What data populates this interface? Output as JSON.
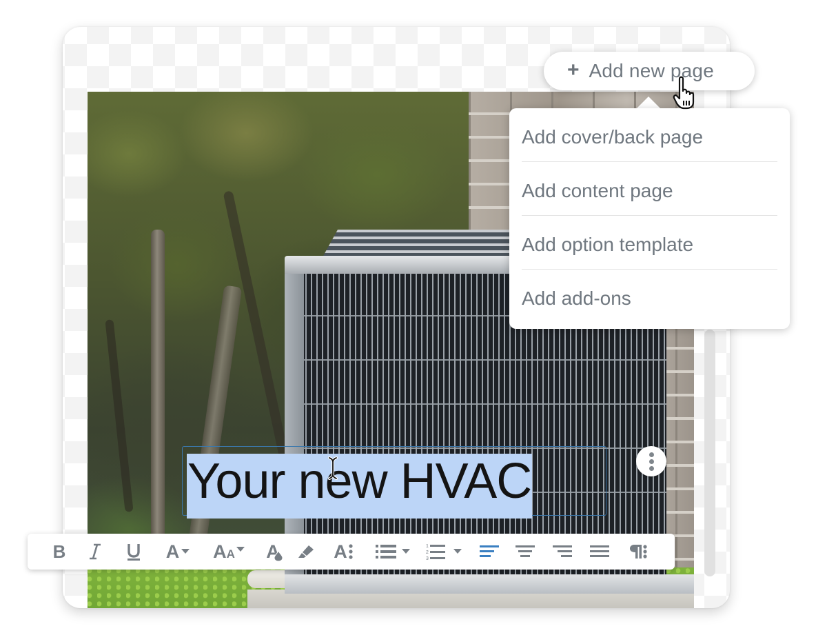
{
  "canvas": {
    "headline_text": "Your new HVAC",
    "selection_color": "#bcd5f7",
    "textbox_border_color": "#3b78ad"
  },
  "add_page": {
    "icon": "plus-icon",
    "label": "Add new page"
  },
  "add_page_menu": {
    "items": [
      {
        "label": "Add cover/back page"
      },
      {
        "label": "Add content page"
      },
      {
        "label": "Add option template"
      },
      {
        "label": "Add add-ons"
      }
    ]
  },
  "toolbar": {
    "buttons": [
      {
        "name": "bold",
        "icon": "bold-icon"
      },
      {
        "name": "italic",
        "icon": "italic-icon"
      },
      {
        "name": "underline",
        "icon": "underline-icon"
      },
      {
        "name": "font-color",
        "icon": "font-color-icon",
        "dropdown": true
      },
      {
        "name": "font-size",
        "icon": "font-size-icon",
        "dropdown": true
      },
      {
        "name": "text-fill",
        "icon": "text-fill-icon"
      },
      {
        "name": "highlight",
        "icon": "highlighter-icon"
      },
      {
        "name": "text-options",
        "icon": "text-options-icon"
      },
      {
        "name": "bulleted-list",
        "icon": "bulleted-list-icon",
        "dropdown": true
      },
      {
        "name": "numbered-list",
        "icon": "numbered-list-icon",
        "dropdown": true
      },
      {
        "name": "align-left",
        "icon": "align-left-icon",
        "active": true
      },
      {
        "name": "align-center",
        "icon": "align-center-icon"
      },
      {
        "name": "align-right",
        "icon": "align-right-icon"
      },
      {
        "name": "justify",
        "icon": "justify-icon"
      },
      {
        "name": "paragraph-options",
        "icon": "paragraph-options-icon"
      }
    ],
    "icon_color": "#777e85",
    "active_color": "#3a7fc1",
    "letters": {
      "font_color": "A",
      "font_size_big": "A",
      "font_size_small": "A",
      "text_fill": "A",
      "text_options": "A",
      "bold": "B",
      "numbers": [
        "1",
        "2",
        "3"
      ]
    }
  },
  "more_button": {
    "icon": "more-vertical-icon"
  }
}
